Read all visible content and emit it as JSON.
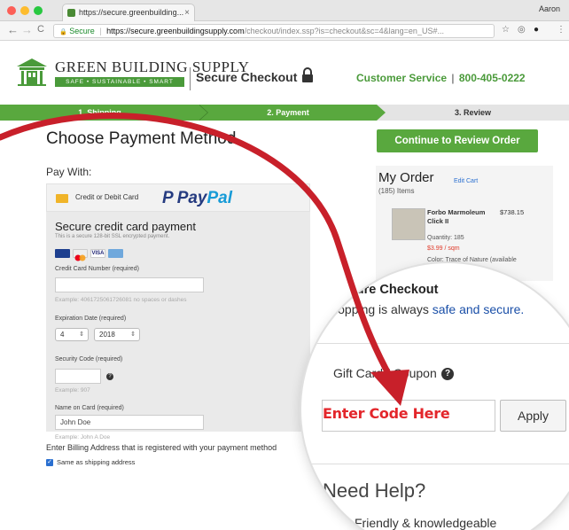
{
  "browser": {
    "tab_title": "https://secure.greenbuilding...",
    "tab_close": "×",
    "user_name": "Aaron",
    "back": "←",
    "forward": "→",
    "reload": "C",
    "lock": "🔒",
    "secure_label": "Secure",
    "url_host": "https://secure.greenbuildingsupply.com",
    "url_path": "/checkout/index.ssp?is=checkout&sc=4&lang=en_US#...",
    "star": "☆",
    "ext1": "◎",
    "ext2": "●",
    "menu": "⋮"
  },
  "header": {
    "brand": "GREEN BUILDING SUPPLY",
    "tagline": "SAFE • SUSTAINABLE • SMART",
    "secure_checkout": "Secure Checkout",
    "customer_service": "Customer Service",
    "separator": "|",
    "phone": "800-405-0222"
  },
  "steps": [
    {
      "label": "1. Shipping"
    },
    {
      "label": "2. Payment"
    },
    {
      "label": "3. Review"
    }
  ],
  "main": {
    "title": "Choose Payment Method",
    "continue_label": "Continue to Review Order",
    "pay_with": "Pay With:",
    "card_tab_label": "Credit or Debit Card",
    "paypal_pay": "Pay",
    "paypal_pal": "Pal",
    "cc_title": "Secure credit card payment",
    "cc_sub": "This is a secure 128-bit SSL encrypted payment.",
    "card_number_label": "Credit Card Number (required)",
    "card_number_value": "",
    "card_number_example": "Example: 4061725061726081 no spaces or dashes",
    "expiry_label": "Expiration Date (required)",
    "expiry_month": "4",
    "expiry_year": "2018",
    "select_arrow": "⇕",
    "security_label": "Security Code (required)",
    "security_value": "",
    "security_help": "?",
    "security_example": "Example: 907",
    "name_label": "Name on Card (required)",
    "name_value": "John Doe",
    "name_example": "Example: John A Doe",
    "billing_label": "Enter Billing Address that is registered with your payment method",
    "same_as_shipping": "Same as shipping address",
    "checkmark": "✓"
  },
  "order": {
    "title": "My Order",
    "edit_cart": "Edit Cart",
    "items_count": "(185) Items",
    "product_name": "Forbo Marmoleum Click II",
    "product_price": "$738.15",
    "quantity": "Quantity: 185",
    "unit_price": "$3.99 / sqm",
    "color": "Color: Trace of Nature (available"
  },
  "magnifier": {
    "secure_heading": "Secure Checkout",
    "secure_text": "Shopping is always",
    "secure_link": "safe and secure.",
    "gift_label": "Gift Card / Coupon",
    "gift_help": "?",
    "coupon_placeholder": "Enter Code Here",
    "apply_label": "Apply",
    "need_help": "Need Help?",
    "friendly_text": "Friendly & knowledgeable"
  },
  "colors": {
    "accent_green": "#59a83e",
    "arrow_red": "#c8202a",
    "placeholder_red": "#e3262b"
  }
}
